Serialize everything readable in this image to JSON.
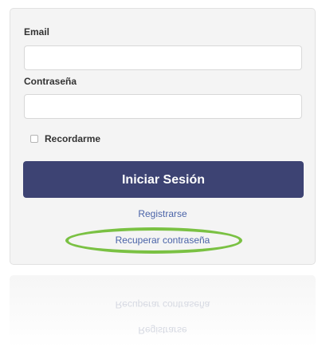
{
  "form": {
    "email_label": "Email",
    "email_value": "",
    "password_label": "Contraseña",
    "password_value": "",
    "remember_label": "Recordarme",
    "remember_checked": false,
    "login_button": "Iniciar Sesión",
    "register_link": "Registrarse",
    "recover_link": "Recuperar contraseña"
  },
  "colors": {
    "button": "#3d4373",
    "link": "#4a63a8",
    "highlight": "#7ac143",
    "card": "#f4f4f4"
  }
}
